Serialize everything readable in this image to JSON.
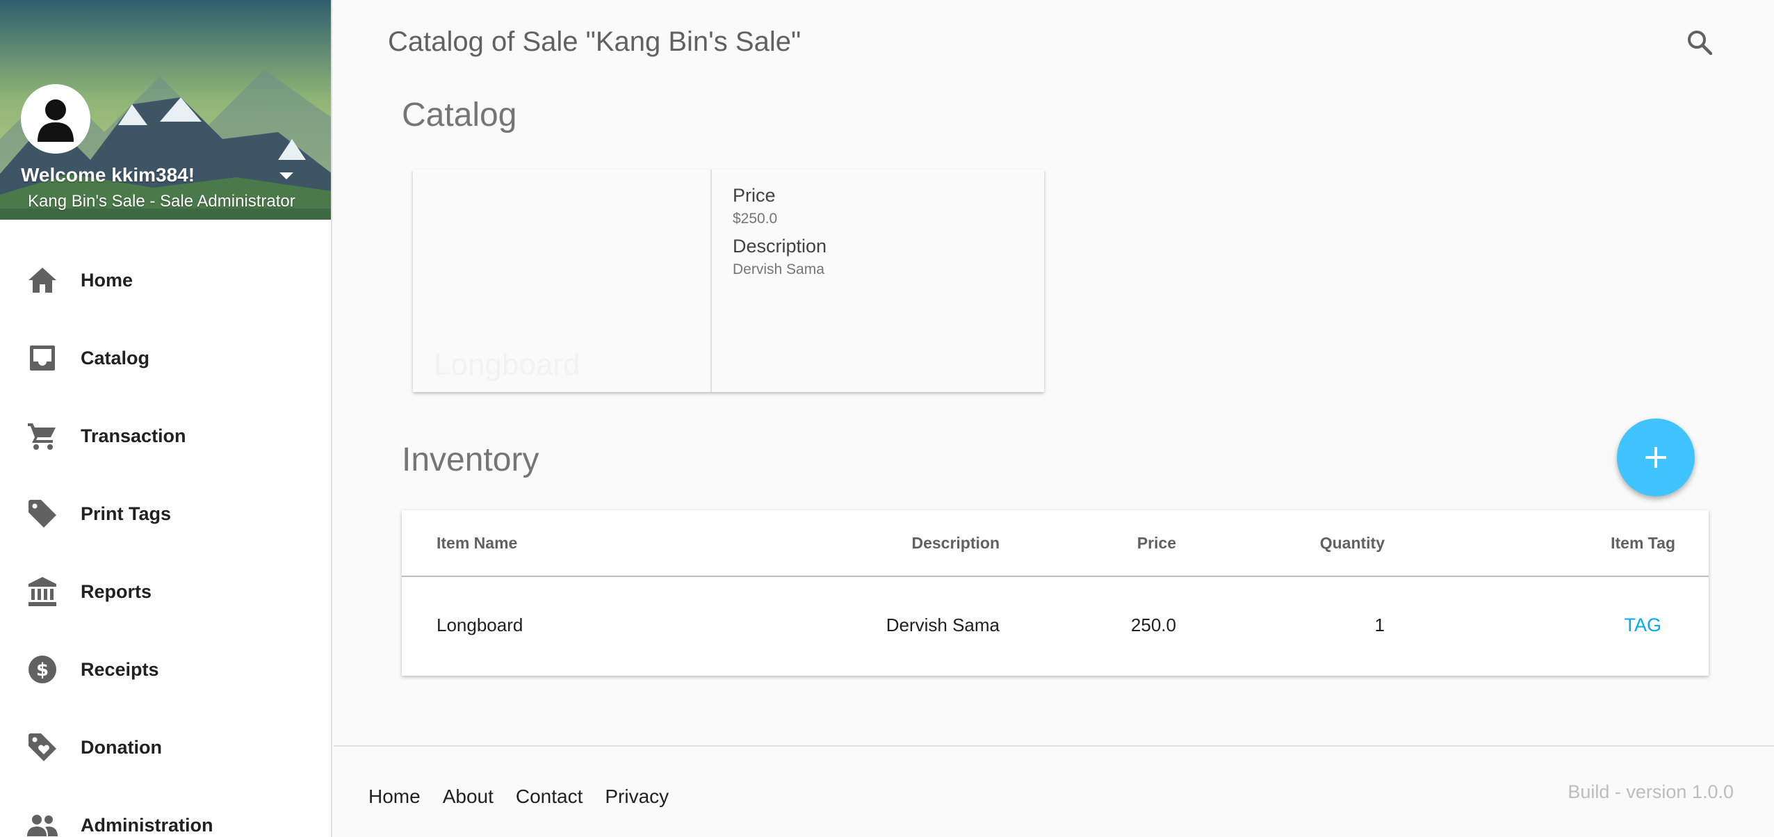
{
  "user": {
    "welcome": "Welcome kkim384!",
    "role": "Kang Bin's Sale - Sale Administrator"
  },
  "nav": {
    "items": [
      {
        "label": "Home",
        "icon": "home-icon"
      },
      {
        "label": "Catalog",
        "icon": "inbox-icon"
      },
      {
        "label": "Transaction",
        "icon": "cart-icon"
      },
      {
        "label": "Print Tags",
        "icon": "tag-icon"
      },
      {
        "label": "Reports",
        "icon": "bank-icon"
      },
      {
        "label": "Receipts",
        "icon": "dollar-circle-icon"
      },
      {
        "label": "Donation",
        "icon": "heart-tag-icon"
      },
      {
        "label": "Administration",
        "icon": "people-icon"
      }
    ]
  },
  "header": {
    "title": "Catalog of Sale \"Kang Bin's Sale\""
  },
  "catalog": {
    "heading": "Catalog",
    "card": {
      "image_title": "Longboard",
      "price_label": "Price",
      "price_value": "$250.0",
      "description_label": "Description",
      "description_value": "Dervish Sama"
    }
  },
  "inventory": {
    "heading": "Inventory",
    "columns": [
      "Item Name",
      "Description",
      "Price",
      "Quantity",
      "Item Tag"
    ],
    "rows": [
      {
        "name": "Longboard",
        "description": "Dervish Sama",
        "price": "250.0",
        "quantity": "1",
        "tag": "TAG"
      }
    ]
  },
  "footer": {
    "links": [
      "Home",
      "About",
      "Contact",
      "Privacy"
    ],
    "build": "Build - version 1.0.0"
  },
  "colors": {
    "accent": "#40c4ff",
    "link": "#03a9f4"
  }
}
